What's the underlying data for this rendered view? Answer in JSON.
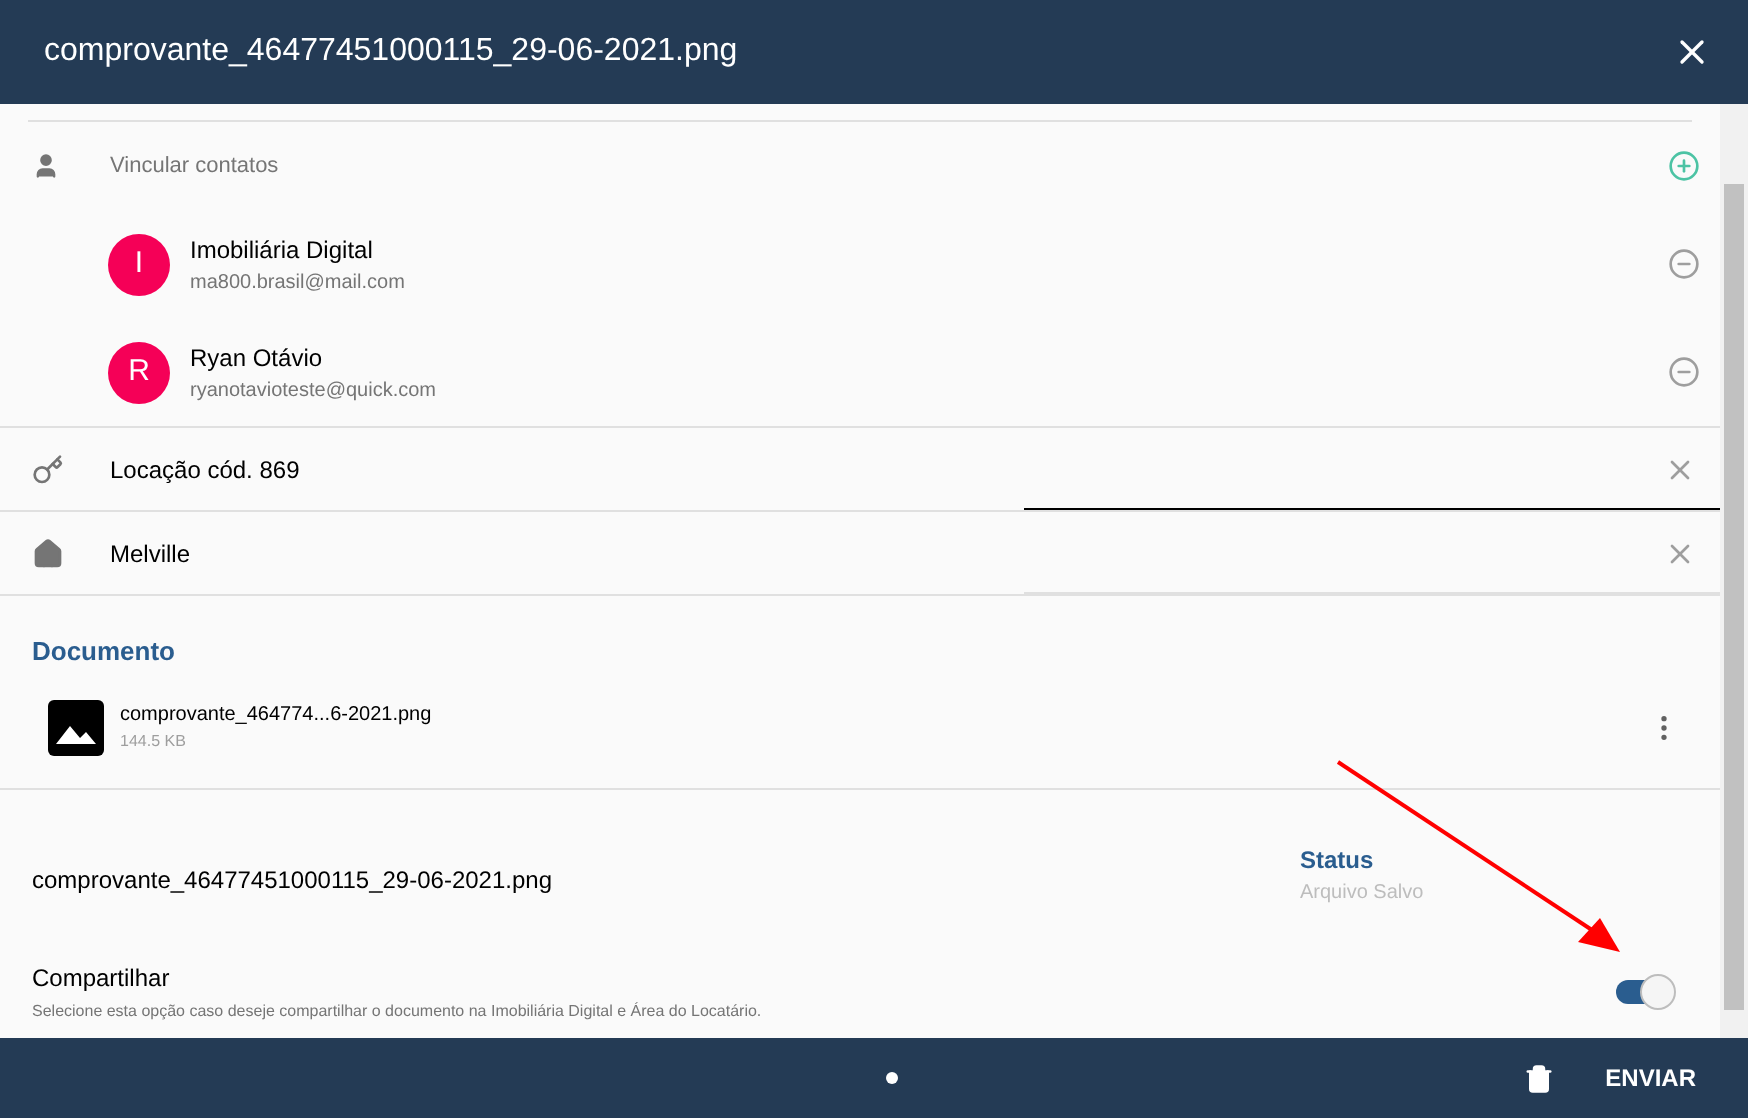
{
  "window": {
    "title": "comprovante_46477451000115_29-06-2021.png"
  },
  "contacts": {
    "label": "Vincular contatos",
    "items": [
      {
        "initial": "I",
        "name": "Imobiliária Digital",
        "email": "ma800.brasil@mail.com",
        "color": "#f50057"
      },
      {
        "initial": "R",
        "name": "Ryan Otávio",
        "email": "ryanotavioteste@quick.com",
        "color": "#f50057"
      }
    ]
  },
  "links": [
    {
      "kind": "key",
      "value": "Locação cód. 869",
      "focused": true
    },
    {
      "kind": "home",
      "value": "Melville",
      "focused": false
    }
  ],
  "document": {
    "heading": "Documento",
    "file_name": "comprovante_464774...6-2021.png",
    "file_size": "144.5 KB"
  },
  "file": {
    "name": "comprovante_46477451000115_29-06-2021.png",
    "status_label": "Status",
    "status_value": "Arquivo Salvo"
  },
  "share": {
    "label": "Compartilhar",
    "description": "Selecione esta opção caso deseje compartilhar o documento na Imobiliária Digital e Área do Locatário.",
    "on": true
  },
  "footer": {
    "dots": [
      {
        "selected": true
      }
    ],
    "send": "ENVIAR"
  }
}
